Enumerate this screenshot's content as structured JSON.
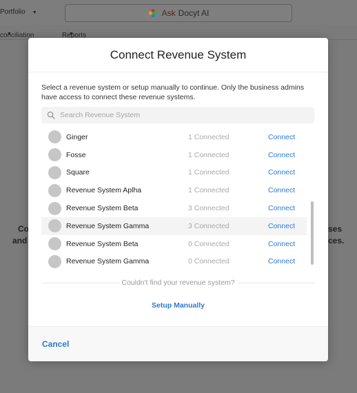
{
  "background": {
    "nav_portfolio": "Portfolio",
    "ask_brand_prefix": "Ask",
    "ask_brand_name": "Docyt AI",
    "subnav_reconciliation": "conciliation",
    "subnav_reports": "Reports",
    "body_left_1": "Co",
    "body_left_2": "and",
    "body_right_1": "ses",
    "body_right_2": "ces."
  },
  "modal": {
    "title": "Connect Revenue System",
    "description": "Select a revenue system or setup manually to continue. Only the business admins have access to connect these revenue systems.",
    "search": {
      "placeholder": "Search Revenue System",
      "value": ""
    },
    "items": [
      {
        "name": "Ginger",
        "status": "1 Connected",
        "action": "Connect",
        "highlight": false
      },
      {
        "name": "Fosse",
        "status": "1 Connected",
        "action": "Connect",
        "highlight": false
      },
      {
        "name": "Square",
        "status": "1 Connected",
        "action": "Connect",
        "highlight": false
      },
      {
        "name": "Revenue System Aplha",
        "status": "1 Connected",
        "action": "Connect",
        "highlight": false
      },
      {
        "name": "Revenue System Beta",
        "status": "3 Connected",
        "action": "Connect",
        "highlight": false
      },
      {
        "name": "Revenue System Gamma",
        "status": "3 Connected",
        "action": "Connect",
        "highlight": true
      },
      {
        "name": "Revenue System Beta",
        "status": "0 Connected",
        "action": "Connect",
        "highlight": false
      },
      {
        "name": "Revenue System Gamma",
        "status": "0 Connected",
        "action": "Connect",
        "highlight": false
      }
    ],
    "not_found_text": "Couldn't find your revenue system?",
    "setup_manually_label": "Setup Manually",
    "cancel_label": "Cancel"
  },
  "colors": {
    "accent": "#2a7ad1",
    "overlay": "#7b7b7b",
    "avatar": "#c6c6c6",
    "muted_text": "#a9a9a9"
  }
}
